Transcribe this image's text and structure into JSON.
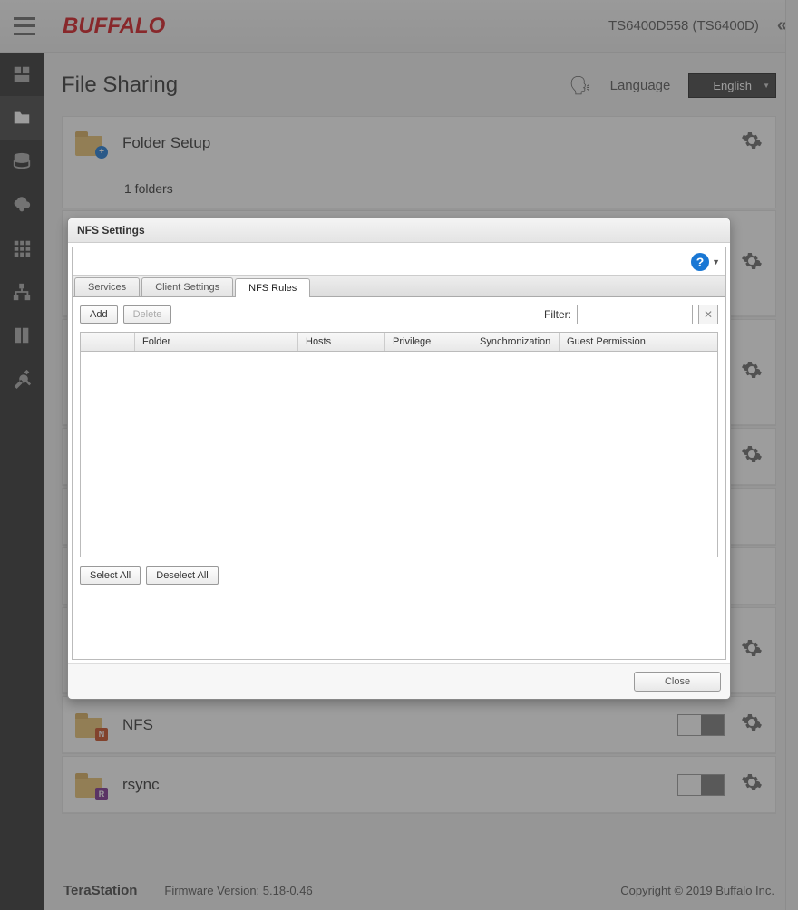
{
  "header": {
    "logo": "BUFFALO",
    "device": "TS6400D558 (TS6400D)"
  },
  "page": {
    "title": "File Sharing",
    "language_label": "Language",
    "language_value": "English"
  },
  "cards": {
    "folder_setup": {
      "title": "Folder Setup",
      "sub": "1 folders"
    },
    "nfs": {
      "title": "NFS"
    },
    "rsync": {
      "title": "rsync"
    }
  },
  "dialog": {
    "title": "NFS Settings",
    "tabs": {
      "services": "Services",
      "client": "Client Settings",
      "rules": "NFS Rules"
    },
    "toolbar": {
      "add": "Add",
      "delete": "Delete",
      "filter_label": "Filter:",
      "filter_value": ""
    },
    "columns": {
      "folder": "Folder",
      "hosts": "Hosts",
      "privilege": "Privilege",
      "sync": "Synchronization",
      "guest": "Guest Permission"
    },
    "select_all": "Select All",
    "deselect_all": "Deselect All",
    "close": "Close"
  },
  "footer": {
    "product": "TeraStation",
    "firmware": "Firmware Version: 5.18-0.46",
    "copyright": "Copyright © 2019 Buffalo Inc."
  }
}
